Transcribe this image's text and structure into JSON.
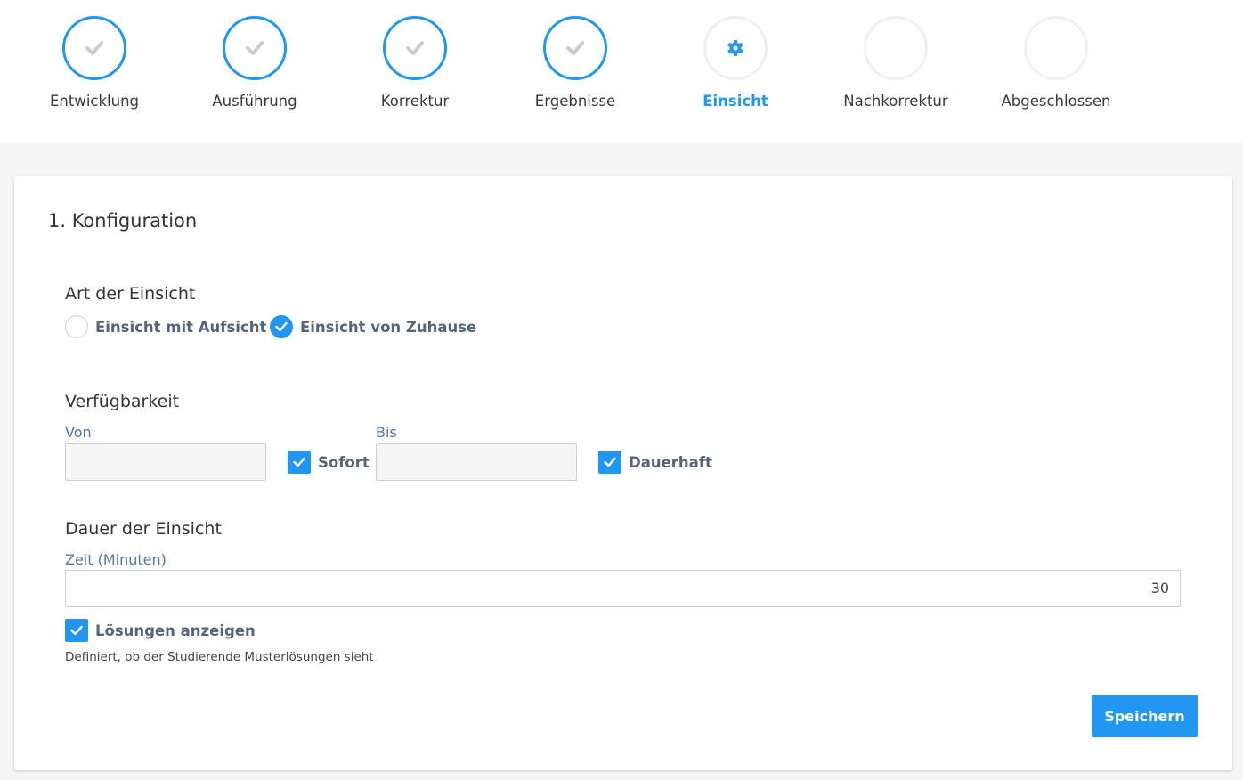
{
  "stepper": {
    "steps": [
      {
        "label": "Entwicklung",
        "state": "done",
        "icon": "check-icon"
      },
      {
        "label": "Ausführung",
        "state": "done",
        "icon": "check-icon"
      },
      {
        "label": "Korrektur",
        "state": "done",
        "icon": "check-icon"
      },
      {
        "label": "Ergebnisse",
        "state": "done",
        "icon": "check-icon"
      },
      {
        "label": "Einsicht",
        "state": "current",
        "icon": "gear-icon"
      },
      {
        "label": "Nachkorrektur",
        "state": "pending",
        "icon": ""
      },
      {
        "label": "Abgeschlossen",
        "state": "pending",
        "icon": ""
      }
    ]
  },
  "config": {
    "title": "1. Konfiguration",
    "art": {
      "title": "Art der Einsicht",
      "options": [
        {
          "label": "Einsicht mit Aufsicht",
          "checked": false
        },
        {
          "label": "Einsicht von Zuhause",
          "checked": true
        }
      ]
    },
    "availability": {
      "title": "Verfügbarkeit",
      "from_label": "Von",
      "from_value": "",
      "immediate_label": "Sofort",
      "immediate_checked": true,
      "to_label": "Bis",
      "to_value": "",
      "permanent_label": "Dauerhaft",
      "permanent_checked": true
    },
    "duration": {
      "title": "Dauer der Einsicht",
      "time_label": "Zeit (Minuten)",
      "time_value": "30",
      "solutions_label": "Lösungen anzeigen",
      "solutions_checked": true,
      "solutions_help": "Definiert, ob der Studierende Musterlösungen sieht"
    },
    "save_label": "Speichern"
  },
  "colors": {
    "accent": "#2196f3",
    "check_gray": "#c8ccd2",
    "option_text": "#57657a",
    "field_label": "#4e79a7"
  }
}
